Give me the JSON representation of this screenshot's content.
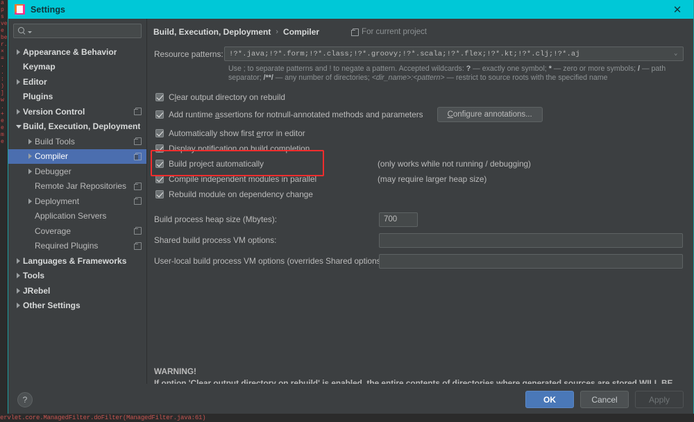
{
  "window": {
    "title": "Settings",
    "app_icon": "intellij-idea-icon",
    "close_label": "✕",
    "title_bar_color": "#00c8d7"
  },
  "sidebar": {
    "search": {
      "placeholder": "",
      "value": "",
      "icon": "search-icon"
    },
    "items": [
      {
        "label": "Appearance & Behavior",
        "twisty": "right",
        "depth": 0,
        "top": true,
        "badge": false,
        "selected": false
      },
      {
        "label": "Keymap",
        "twisty": "none",
        "depth": 0,
        "top": true,
        "badge": false,
        "selected": false
      },
      {
        "label": "Editor",
        "twisty": "right",
        "depth": 0,
        "top": true,
        "badge": false,
        "selected": false
      },
      {
        "label": "Plugins",
        "twisty": "none",
        "depth": 0,
        "top": true,
        "badge": false,
        "selected": false
      },
      {
        "label": "Version Control",
        "twisty": "right",
        "depth": 0,
        "top": true,
        "badge": true,
        "selected": false
      },
      {
        "label": "Build, Execution, Deployment",
        "twisty": "down",
        "depth": 0,
        "top": true,
        "badge": false,
        "selected": false
      },
      {
        "label": "Build Tools",
        "twisty": "right",
        "depth": 1,
        "top": false,
        "badge": true,
        "selected": false
      },
      {
        "label": "Compiler",
        "twisty": "right",
        "depth": 1,
        "top": false,
        "badge": true,
        "selected": true
      },
      {
        "label": "Debugger",
        "twisty": "right",
        "depth": 1,
        "top": false,
        "badge": false,
        "selected": false
      },
      {
        "label": "Remote Jar Repositories",
        "twisty": "none",
        "depth": 1,
        "top": false,
        "badge": true,
        "selected": false
      },
      {
        "label": "Deployment",
        "twisty": "right",
        "depth": 1,
        "top": false,
        "badge": true,
        "selected": false
      },
      {
        "label": "Application Servers",
        "twisty": "none",
        "depth": 1,
        "top": false,
        "badge": false,
        "selected": false
      },
      {
        "label": "Coverage",
        "twisty": "none",
        "depth": 1,
        "top": false,
        "badge": true,
        "selected": false
      },
      {
        "label": "Required Plugins",
        "twisty": "none",
        "depth": 1,
        "top": false,
        "badge": true,
        "selected": false
      },
      {
        "label": "Languages & Frameworks",
        "twisty": "right",
        "depth": 0,
        "top": true,
        "badge": false,
        "selected": false
      },
      {
        "label": "Tools",
        "twisty": "right",
        "depth": 0,
        "top": true,
        "badge": false,
        "selected": false
      },
      {
        "label": "JRebel",
        "twisty": "right",
        "depth": 0,
        "top": true,
        "badge": false,
        "selected": false
      },
      {
        "label": "Other Settings",
        "twisty": "right",
        "depth": 0,
        "top": true,
        "badge": false,
        "selected": false
      }
    ]
  },
  "content": {
    "breadcrumb": {
      "parent": "Build, Execution, Deployment",
      "separator": "›",
      "current": "Compiler"
    },
    "scope_note": {
      "label": "For current project",
      "icon": "project-scope-icon"
    },
    "resource_patterns": {
      "label": "Resource patterns:",
      "value": "!?*.java;!?*.form;!?*.class;!?*.groovy;!?*.scala;!?*.flex;!?*.kt;!?*.clj;!?*.aj",
      "expand_icon": "expand-corner-icon",
      "hint_line_1_a": "Use ; to separate patterns and ! to negate a pattern. Accepted wildcards: ",
      "hint_q": "?",
      "hint_line_1_b": " — exactly one symbol; ",
      "hint_star": "*",
      "hint_line_1_c": " — zero or more symbols; ",
      "hint_slash": "/",
      "hint_line_1_d": " — path",
      "hint_line_2_a": "separator; ",
      "hint_dstar": "/**/",
      "hint_line_2_b": " — any number of directories; ",
      "hint_dir": "<dir_name>:<pattern>",
      "hint_line_2_c": " — restrict to source roots with the specified name"
    },
    "checkboxes": [
      {
        "label_pre": "C",
        "label_mnemonic": "l",
        "label_post": "ear output directory on rebuild",
        "checked": true,
        "note": ""
      },
      {
        "label_pre": "Add runtime ",
        "label_mnemonic": "a",
        "label_post": "ssertions for notnull-annotated methods and parameters",
        "checked": true,
        "note": ""
      },
      {
        "label_pre": "Automatically show first ",
        "label_mnemonic": "e",
        "label_post": "rror in editor",
        "checked": true,
        "note": ""
      },
      {
        "label_pre": "Display notification on build completion",
        "label_mnemonic": "",
        "label_post": "",
        "checked": true,
        "note": ""
      },
      {
        "label_pre": "Build project automatically",
        "label_mnemonic": "",
        "label_post": "",
        "checked": true,
        "note": "(only works while not running / debugging)"
      },
      {
        "label_pre": "Compile independent modules in parallel",
        "label_mnemonic": "",
        "label_post": "",
        "checked": true,
        "note": "(may require larger heap size)"
      },
      {
        "label_pre": "Rebuild module on dependency change",
        "label_mnemonic": "",
        "label_post": "",
        "checked": true,
        "note": ""
      }
    ],
    "configure_annotations": {
      "label_pre": "",
      "label_mnemonic": "C",
      "label_post": "onfigure annotations..."
    },
    "highlight": {
      "color": "#f42d2d",
      "targets": [
        "Build project automatically",
        "Compile independent modules in parallel"
      ]
    },
    "fields": [
      {
        "label": "Build process heap size (Mbytes):",
        "value": "700",
        "kind": "small"
      },
      {
        "label": "Shared build process VM options:",
        "value": "",
        "kind": "wide"
      },
      {
        "label": "User-local build process VM options (overrides Shared options):",
        "value": "",
        "kind": "wide"
      }
    ],
    "warning": {
      "heading": "WARNING!",
      "body": "If option 'Clear output directory on rebuild' is enabled, the entire contents of directories where generated sources are stored WILL BE CLEARED on rebuild."
    }
  },
  "footer": {
    "help_label": "?",
    "buttons": [
      {
        "label": "OK",
        "style": "primary"
      },
      {
        "label": "Cancel",
        "style": "normal"
      },
      {
        "label": "Apply",
        "style": "disabled"
      }
    ]
  },
  "backdrop": {
    "console_line": "ervlet.core.ManagedFilter.doFilter(ManagedFilter.java:61)"
  }
}
